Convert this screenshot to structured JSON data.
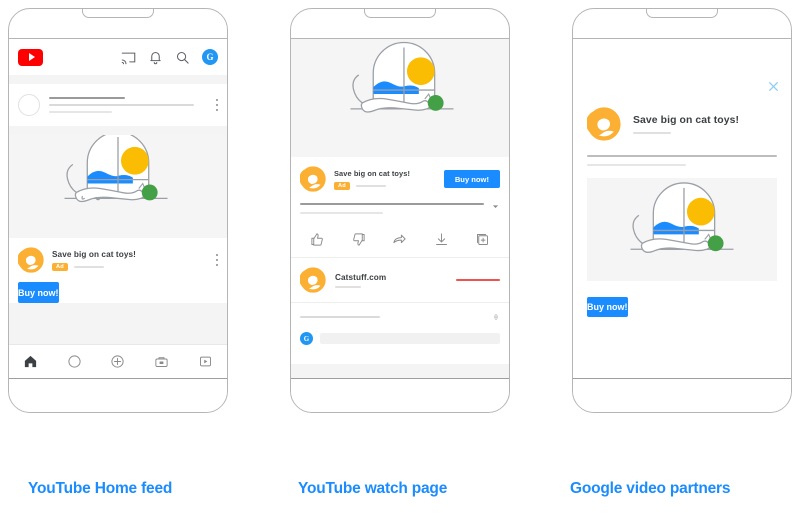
{
  "captions": [
    {
      "label": "YouTube Home feed"
    },
    {
      "label": "YouTube watch page"
    },
    {
      "label": "Google video partners"
    }
  ],
  "colors": {
    "accent_blue": "#1a8cff",
    "youtube_red": "#ff0000",
    "ad_badge_orange": "#fbb034",
    "brand_orange": "#fbb034",
    "ball_green": "#43a047",
    "sun_yellow": "#fbbc04",
    "hills_blue": "#1a8cff",
    "subscribe_red": "#ef5350",
    "frame_gray": "#b5b5b5"
  },
  "ad": {
    "headline": "Save big on cat toys!",
    "badge": "Ad",
    "cta": "Buy now!",
    "advertiser": "Catstuff.com",
    "logo_icon": "cat-logo-icon"
  },
  "phone_home": {
    "topbar": {
      "logo_icon": "youtube-logo-icon",
      "icons": [
        "cast-icon",
        "bell-icon",
        "search-icon"
      ],
      "avatar_label": "G"
    },
    "nav_items": [
      {
        "icon": "home-icon"
      },
      {
        "icon": "explore-icon"
      },
      {
        "icon": "create-icon"
      },
      {
        "icon": "subscriptions-icon"
      },
      {
        "icon": "library-icon"
      }
    ]
  },
  "phone_watch": {
    "actions": [
      {
        "icon": "like-icon"
      },
      {
        "icon": "dislike-icon"
      },
      {
        "icon": "share-icon"
      },
      {
        "icon": "download-icon"
      },
      {
        "icon": "save-icon"
      }
    ],
    "expand_icon": "chevron-down-icon",
    "sort_icon": "sort-icon",
    "comment_avatar_label": "G"
  },
  "phone_partners": {
    "close_icon": "close-icon"
  },
  "illustration": {
    "name": "cat-stretching-window-illustration",
    "elements": [
      "cat",
      "green-ball",
      "arched-window",
      "sun",
      "blue-hills",
      "floor-line"
    ]
  }
}
